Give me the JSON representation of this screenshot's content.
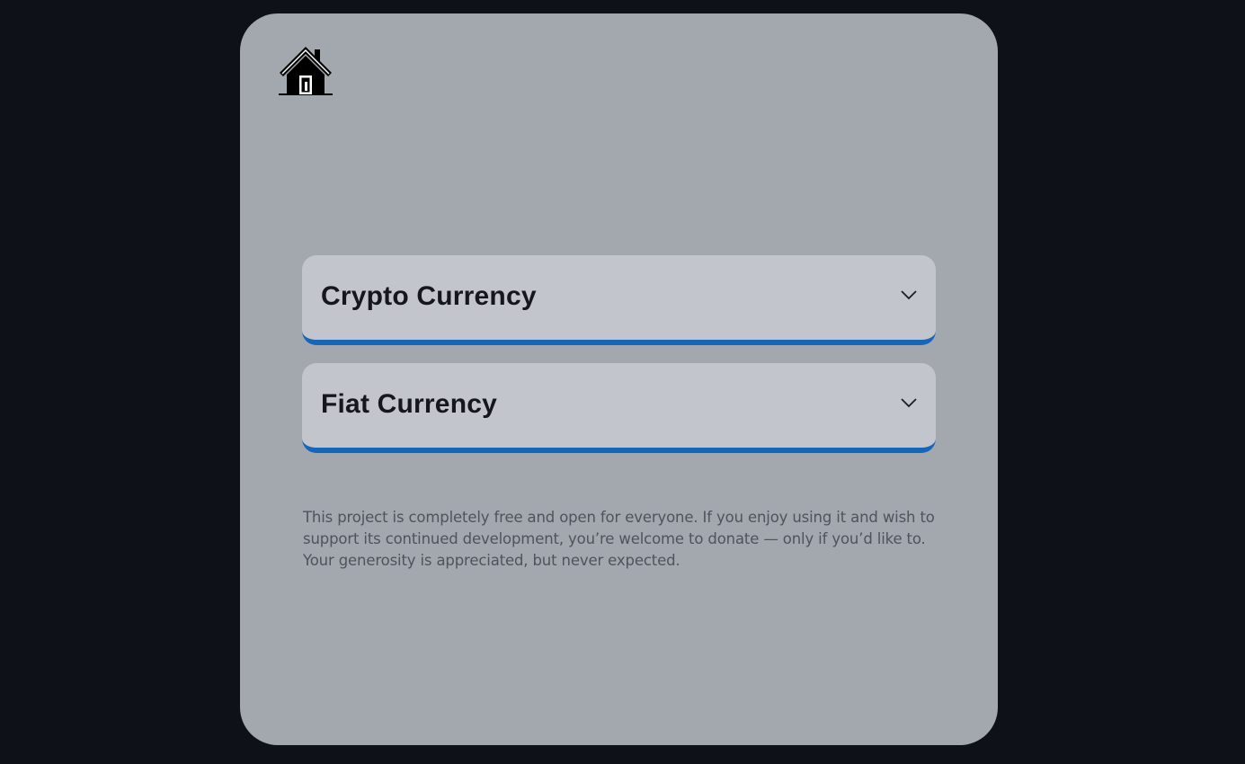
{
  "home": {
    "icon": "home-icon"
  },
  "accordions": [
    {
      "label": "Crypto Currency",
      "icon": "chevron-down-icon"
    },
    {
      "label": "Fiat Currency",
      "icon": "chevron-down-icon"
    }
  ],
  "note": "This project is completely free and open for everyone. If you enjoy using it and wish to support its continued development, you’re welcome to donate — only if you’d like to. Your generosity is appreciated, but never expected.",
  "colors": {
    "page_background": "#0e1118",
    "card_background": "#a3a7ae",
    "accordion_background": "#c2c5cc",
    "accent": "#1565b8"
  }
}
